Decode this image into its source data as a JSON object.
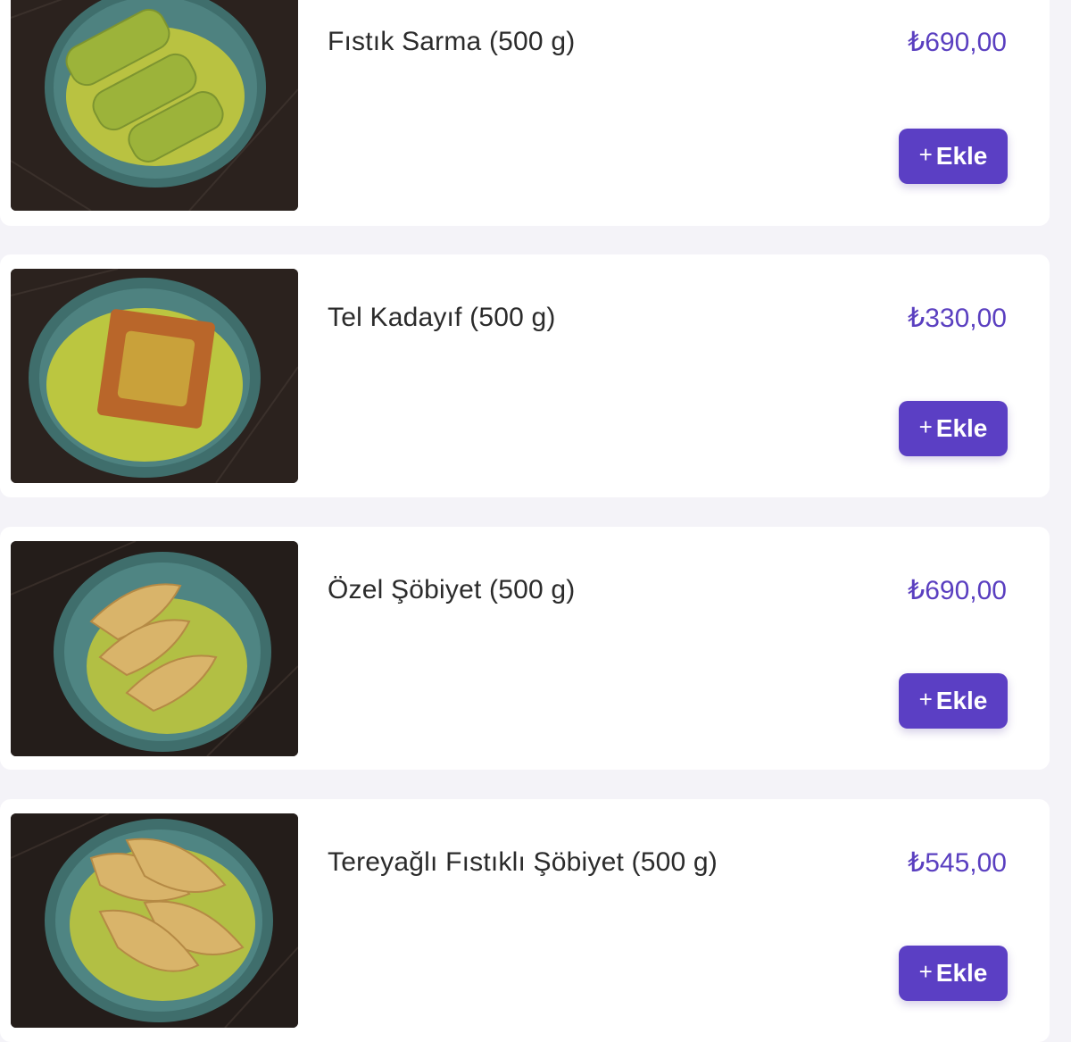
{
  "colors": {
    "accent": "#5b3fc4",
    "price": "#5a3fc0",
    "card_background": "#ffffff",
    "page_background": "#f4f3f8"
  },
  "products": [
    {
      "name": "Fıstık Sarma (500 g)",
      "price": "₺690,00",
      "button_plus": "+",
      "button_label": "Ekle",
      "image_icon": "pistachio-roll-dessert-photo"
    },
    {
      "name": "Tel Kadayıf (500 g)",
      "price": "₺330,00",
      "button_plus": "+",
      "button_label": "Ekle",
      "image_icon": "kadayif-dessert-photo"
    },
    {
      "name": "Özel Şöbiyet (500 g)",
      "price": "₺690,00",
      "button_plus": "+",
      "button_label": "Ekle",
      "image_icon": "sobiyet-dessert-photo"
    },
    {
      "name": "Tereyağlı Fıstıklı Şöbiyet (500 g)",
      "price": "₺545,00",
      "button_plus": "+",
      "button_label": "Ekle",
      "image_icon": "butter-pistachio-sobiyet-photo"
    }
  ]
}
